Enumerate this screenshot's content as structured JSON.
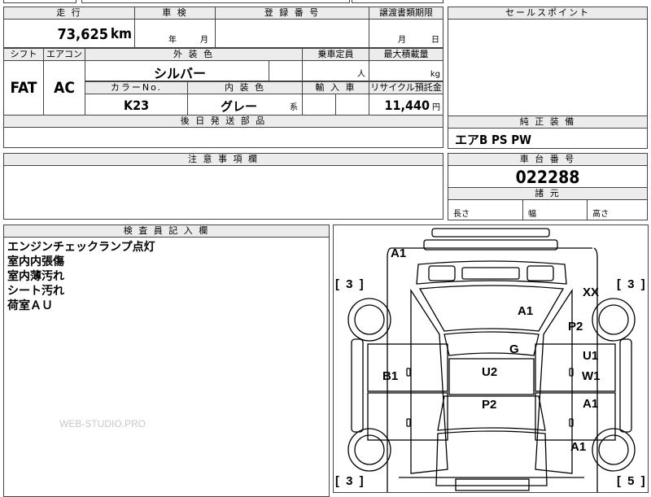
{
  "sheet": {
    "mileage_header": "走 行",
    "mileage_value": "73,625",
    "mileage_unit": "km",
    "inspection_header": "車 検",
    "inspection_year": "年",
    "inspection_month": "月",
    "registration_header": "登 録 番 号",
    "transfer_header": "譲渡書類期限",
    "transfer_month": "月",
    "transfer_day": "日",
    "sales_point_header": "セールスポイント",
    "shift_header": "シフト",
    "shift_value": "FAT",
    "aircon_header": "エアコン",
    "aircon_value": "AC",
    "exterior_color_header": "外 装 色",
    "exterior_color_value": "シルバー",
    "capacity_header": "乗車定員",
    "capacity_unit": "人",
    "max_load_header": "最大積載量",
    "max_load_unit": "kg",
    "color_no_header": "カラーNo.",
    "color_no_value": "K23",
    "interior_color_header": "内 装 色",
    "interior_color_value": "グレー",
    "interior_color_suffix": "系",
    "import_header": "輸 入 車",
    "recycle_header": "リサイクル預託金",
    "recycle_value": "11,440",
    "recycle_unit": "円",
    "later_parts_header": "後 日 発 送 部 品",
    "genuine_equipment_header": "純 正 装 備",
    "genuine_equipment_value": "エアB PS PW",
    "notes_header": "注 意 事 項 欄",
    "chassis_number_header": "車 台 番 号",
    "chassis_number_value": "022288",
    "dimensions_header": "諸 元",
    "length_label": "長さ",
    "width_label": "幅",
    "height_label": "高さ",
    "inspector_header": "検 査 員 記 入 欄",
    "inspector_lines": [
      "エンジンチェックランプ点灯",
      "室内内張傷",
      "室内薄汚れ",
      "シート汚れ",
      "荷室ＡＵ"
    ],
    "watermark": "WEB-STUDIO.PRO"
  },
  "diagram": {
    "marks": [
      {
        "label": "A1"
      },
      {
        "label": "XX"
      },
      {
        "label": "A1"
      },
      {
        "label": "P2"
      },
      {
        "label": "G"
      },
      {
        "label": "U1"
      },
      {
        "label": "W1"
      },
      {
        "label": "B1"
      },
      {
        "label": "U2"
      },
      {
        "label": "A1"
      },
      {
        "label": "P2"
      },
      {
        "label": "A1"
      }
    ],
    "tire_depths": [
      "[ 3 ]",
      "[ 3 ]",
      "[ 3 ]",
      "[ 5 ]"
    ],
    "accent_color": "#000000",
    "header_fill": "#ececec"
  }
}
